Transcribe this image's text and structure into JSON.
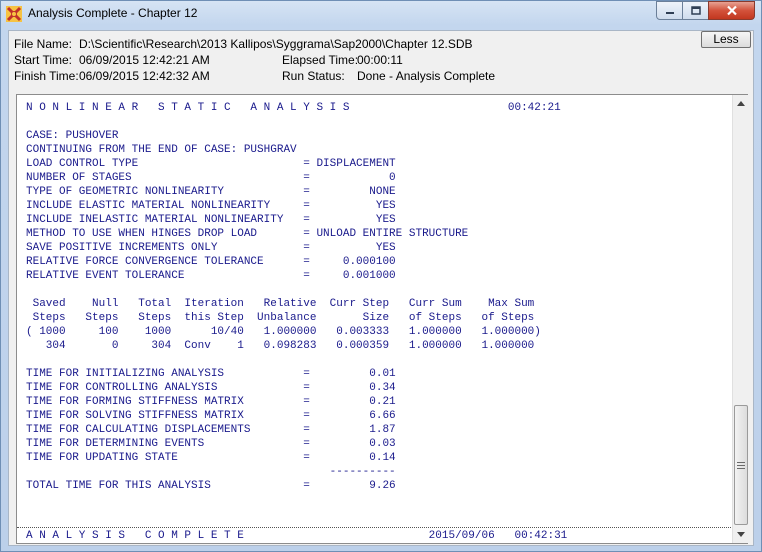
{
  "window": {
    "title": "Analysis Complete - Chapter 12",
    "icons": [
      "sap2000-app-icon",
      "minimize-icon",
      "maximize-icon",
      "close-icon"
    ]
  },
  "info": {
    "file_name_label": "File Name:",
    "file_name": "D:\\Scientific\\Research\\2013 Kallipos\\Syggrama\\Sap2000\\Chapter 12.SDB",
    "start_time_label": "Start Time:",
    "start_time": "06/09/2015  12:42:21 AM",
    "finish_time_label": "Finish Time:",
    "finish_time": "06/09/2015  12:42:32 AM",
    "elapsed_label": "Elapsed Time:",
    "elapsed": "00:00:11",
    "run_status_label": "Run Status:",
    "run_status": "Done - Analysis Complete",
    "less_button": "Less"
  },
  "output_lines": [
    "N O N L I N E A R   S T A T I C   A N A L Y S I S                        00:42:21",
    "",
    "CASE: PUSHOVER",
    "CONTINUING FROM THE END OF CASE: PUSHGRAV",
    "LOAD CONTROL TYPE                         = DISPLACEMENT",
    "NUMBER OF STAGES                          =            0",
    "TYPE OF GEOMETRIC NONLINEARITY            =         NONE",
    "INCLUDE ELASTIC MATERIAL NONLINEARITY     =          YES",
    "INCLUDE INELASTIC MATERIAL NONLINEARITY   =          YES",
    "METHOD TO USE WHEN HINGES DROP LOAD       = UNLOAD ENTIRE STRUCTURE",
    "SAVE POSITIVE INCREMENTS ONLY             =          YES",
    "RELATIVE FORCE CONVERGENCE TOLERANCE      =     0.000100",
    "RELATIVE EVENT TOLERANCE                  =     0.001000",
    "",
    " Saved    Null   Total  Iteration   Relative  Curr Step   Curr Sum    Max Sum",
    " Steps   Steps   Steps  this Step  Unbalance       Size   of Steps   of Steps",
    "( 1000     100    1000      10/40   1.000000   0.003333   1.000000   1.000000)",
    "   304       0     304  Conv    1   0.098283   0.000359   1.000000   1.000000",
    "",
    "TIME FOR INITIALIZING ANALYSIS            =         0.01",
    "TIME FOR CONTROLLING ANALYSIS             =         0.34",
    "TIME FOR FORMING STIFFNESS MATRIX         =         0.21",
    "TIME FOR SOLVING STIFFNESS MATRIX         =         6.66",
    "TIME FOR CALCULATING DISPLACEMENTS        =         1.87",
    "TIME FOR DETERMINING EVENTS               =         0.03",
    "TIME FOR UPDATING STATE                   =         0.14",
    "                                              ----------",
    "TOTAL TIME FOR THIS ANALYSIS              =         9.26"
  ],
  "status_line": "A N A L Y S I S   C O M P L E T E                            2015/09/06   00:42:31",
  "scrollbar": {
    "icons": [
      "scroll-up-arrow-icon",
      "scroll-down-arrow-icon",
      "scroll-grip-icon"
    ]
  }
}
